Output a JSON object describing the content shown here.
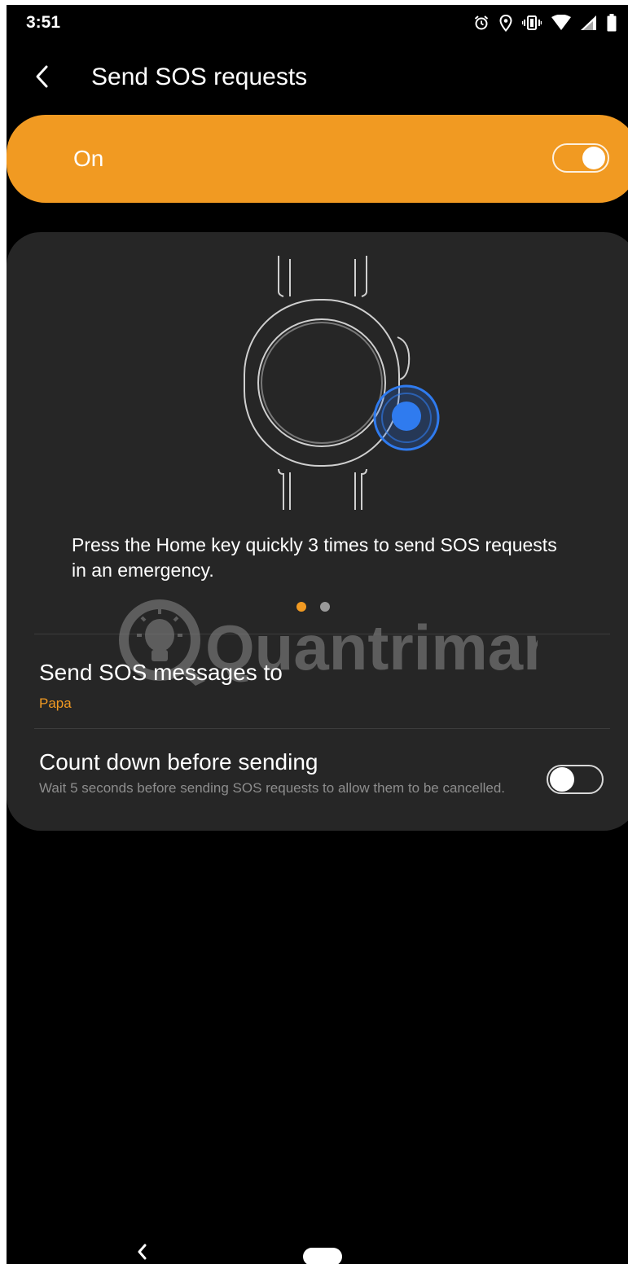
{
  "status_bar": {
    "time": "3:51",
    "icons": [
      "alarm-icon",
      "location-icon",
      "vibrate-icon",
      "wifi-icon",
      "signal-icon",
      "battery-icon"
    ]
  },
  "app_bar": {
    "back_icon": "chevron-left-icon",
    "title": "Send SOS requests"
  },
  "master_switch": {
    "label": "On",
    "state": "on",
    "color": "#f19a22"
  },
  "card": {
    "illustration": "watch-home-key-illustration",
    "help_text": "Press the Home key quickly 3 times to send SOS requests in an emergency.",
    "pager": {
      "total": 2,
      "active": 1
    },
    "watermark": "Quantrimang",
    "sos_messages": {
      "title": "Send SOS messages to",
      "value": "Papa",
      "value_color": "#f19a22"
    },
    "countdown": {
      "title": "Count down before sending",
      "description": "Wait 5 seconds before sending SOS requests to allow them to be cancelled.",
      "state": "off"
    }
  },
  "nav_bar": {
    "back_icon": "chevron-left-icon",
    "home_icon": "home-pill-icon"
  }
}
